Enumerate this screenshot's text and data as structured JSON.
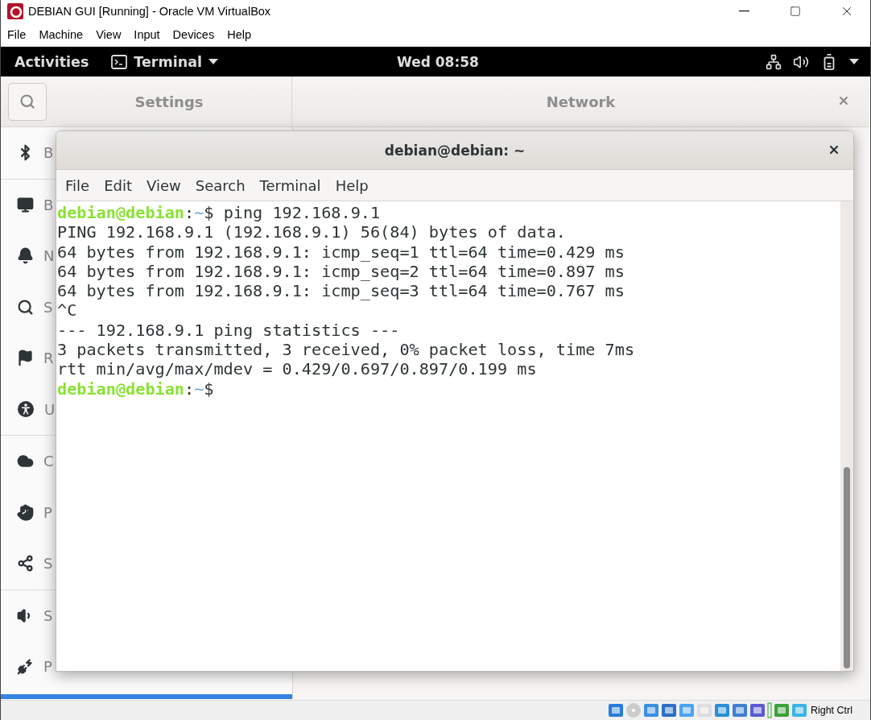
{
  "window": {
    "title": "DEBIAN GUI [Running] - Oracle VM VirtualBox"
  },
  "menu": [
    "File",
    "Machine",
    "View",
    "Input",
    "Devices",
    "Help"
  ],
  "top_bar": {
    "activities": "Activities",
    "app": "Terminal",
    "clock": "Wed 08:58"
  },
  "settings": {
    "title": "Settings",
    "panel_title": "Network",
    "groups": [
      {
        "items": [
          {
            "kind": "bluetooth",
            "label": "B"
          }
        ]
      },
      {
        "items": [
          {
            "kind": "background",
            "label": "B"
          },
          {
            "kind": "notifications",
            "label": "N"
          },
          {
            "kind": "search",
            "label": "S"
          },
          {
            "kind": "region",
            "label": "R"
          },
          {
            "kind": "access",
            "label": "U"
          }
        ]
      },
      {
        "items": [
          {
            "kind": "online",
            "label": "C"
          },
          {
            "kind": "privacy",
            "label": "P"
          },
          {
            "kind": "sharing",
            "label": "S"
          }
        ]
      },
      {
        "items": [
          {
            "kind": "sound",
            "label": "S"
          },
          {
            "kind": "power",
            "label": "P"
          }
        ]
      }
    ]
  },
  "terminal": {
    "title": "debian@debian: ~",
    "menu": [
      "File",
      "Edit",
      "View",
      "Search",
      "Terminal",
      "Help"
    ],
    "lines": [
      {
        "kind": "prompt",
        "user": "debian@debian",
        "sep": ":",
        "path": "~",
        "text": "$ ping 192.168.9.1"
      },
      {
        "kind": "output",
        "text": "PING 192.168.9.1 (192.168.9.1) 56(84) bytes of data."
      },
      {
        "kind": "output",
        "text": "64 bytes from 192.168.9.1: icmp_seq=1 ttl=64 time=0.429 ms"
      },
      {
        "kind": "output",
        "text": "64 bytes from 192.168.9.1: icmp_seq=2 ttl=64 time=0.897 ms"
      },
      {
        "kind": "output",
        "text": "64 bytes from 192.168.9.1: icmp_seq=3 ttl=64 time=0.767 ms"
      },
      {
        "kind": "output",
        "text": "^C"
      },
      {
        "kind": "output",
        "text": "--- 192.168.9.1 ping statistics ---"
      },
      {
        "kind": "output",
        "text": "3 packets transmitted, 3 received, 0% packet loss, time 7ms"
      },
      {
        "kind": "output",
        "text": "rtt min/avg/max/mdev = 0.429/0.697/0.897/0.199 ms"
      },
      {
        "kind": "prompt",
        "user": "debian@debian",
        "sep": ":",
        "path": "~",
        "text": "$"
      }
    ]
  },
  "status_bar": {
    "host_key": "Right Ctrl"
  }
}
